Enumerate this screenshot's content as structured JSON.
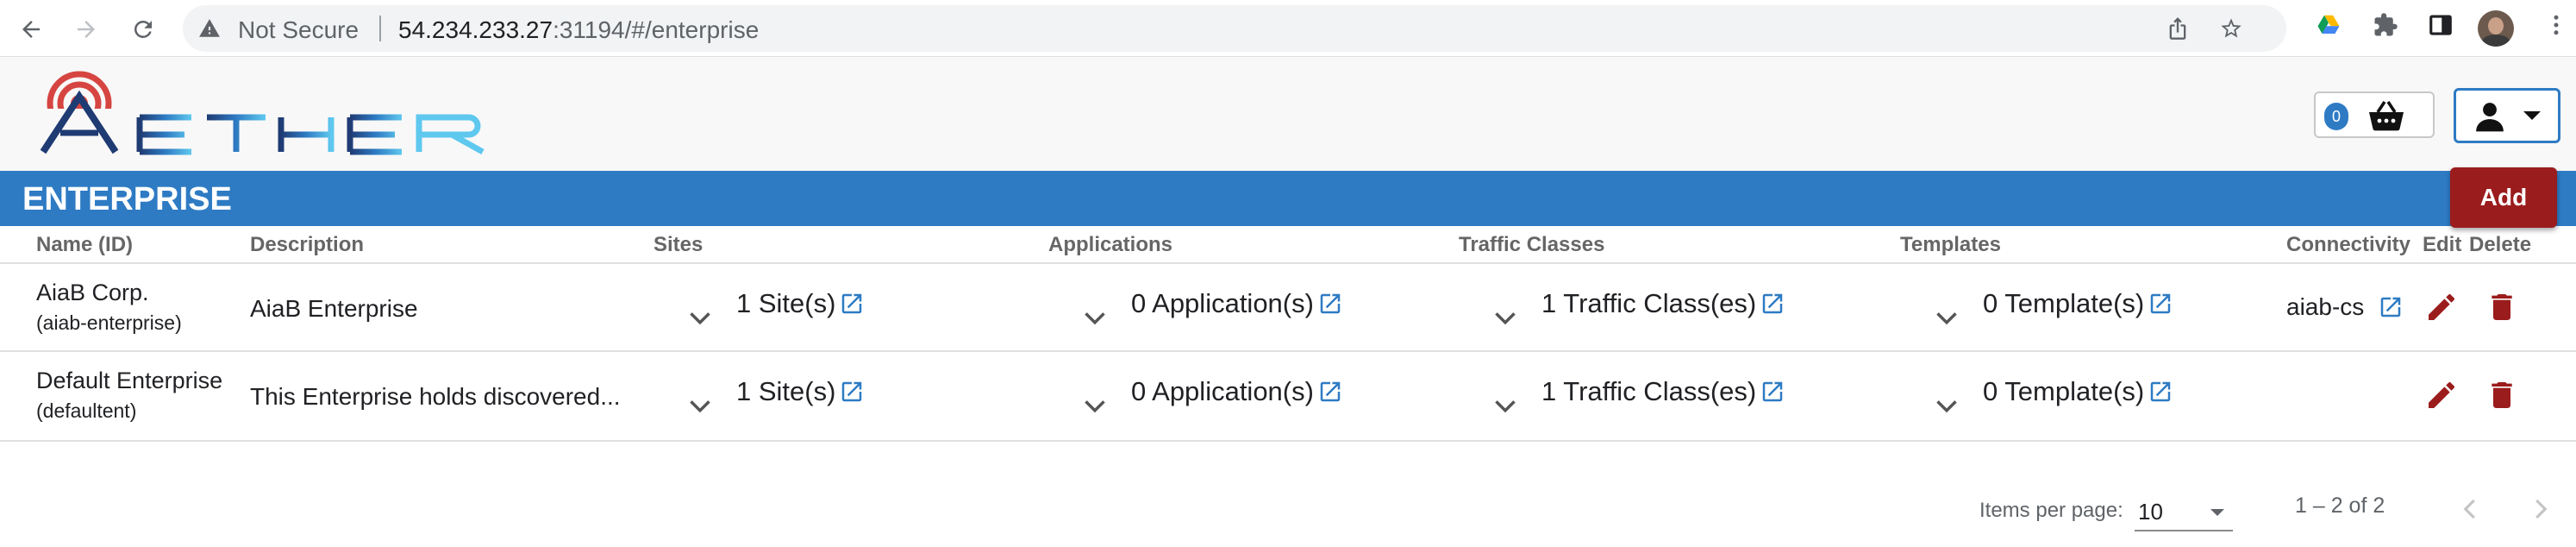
{
  "browser": {
    "security_label": "Not Secure",
    "url_host": "54.234.233.27",
    "url_rest": ":31194/#/enterprise"
  },
  "app": {
    "logo_text": "AETHER",
    "cart_count": "0",
    "accent_color": "#2e7bc4",
    "danger_color": "#9b1c1c"
  },
  "page": {
    "title": "ENTERPRISE",
    "add_label": "Add"
  },
  "table": {
    "headers": {
      "name": "Name (ID)",
      "description": "Description",
      "sites": "Sites",
      "applications": "Applications",
      "traffic_classes": "Traffic Classes",
      "templates": "Templates",
      "connectivity": "Connectivity",
      "edit": "Edit",
      "delete": "Delete"
    },
    "rows": [
      {
        "name": "AiaB Corp.",
        "id": "(aiab-enterprise)",
        "description": "AiaB Enterprise",
        "sites": "1 Site(s)",
        "applications": "0 Application(s)",
        "traffic_classes": "1 Traffic Class(es)",
        "templates": "0 Template(s)",
        "connectivity": "aiab-cs"
      },
      {
        "name": "Default Enterprise",
        "id": "(defaultent)",
        "description": "This Enterprise holds discovered...",
        "sites": "1 Site(s)",
        "applications": "0 Application(s)",
        "traffic_classes": "1 Traffic Class(es)",
        "templates": "0 Template(s)",
        "connectivity": ""
      }
    ]
  },
  "paginator": {
    "items_per_page_label": "Items per page:",
    "page_size": "10",
    "range_label": "1 – 2 of 2"
  },
  "icons": {
    "external_link": "open-in-new-icon",
    "expand": "chevron-down-icon",
    "edit": "pencil-icon",
    "delete": "trash-icon"
  }
}
